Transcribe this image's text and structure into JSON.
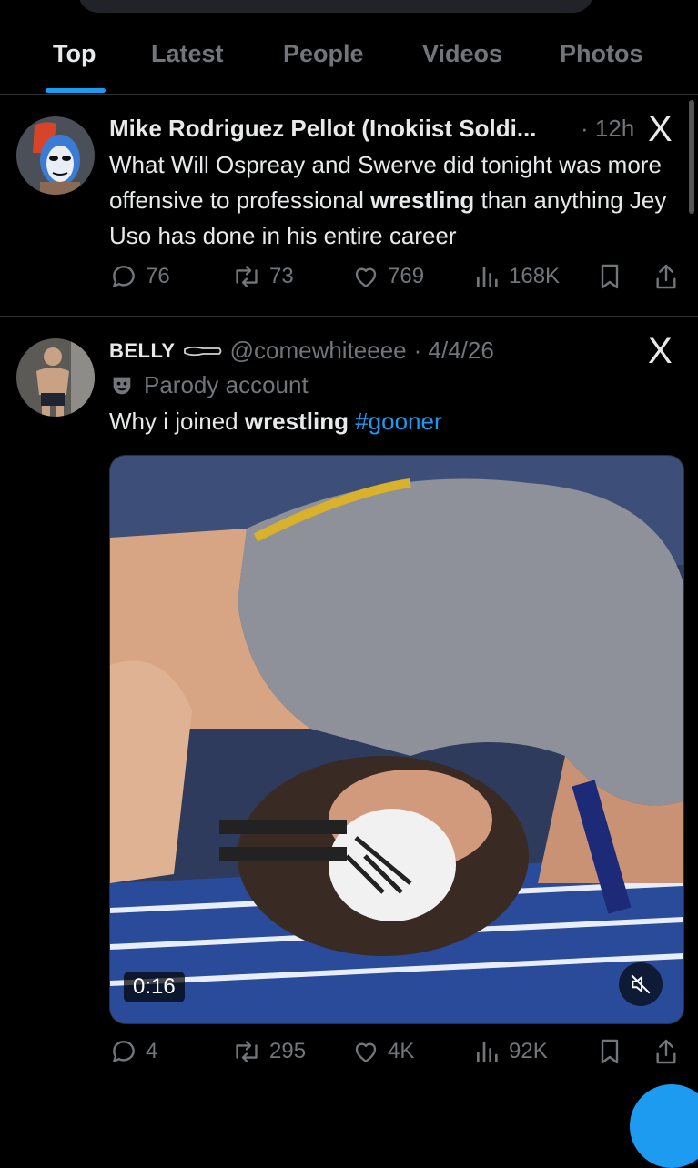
{
  "tabs": [
    {
      "label": "Top",
      "active": true
    },
    {
      "label": "Latest",
      "active": false
    },
    {
      "label": "People",
      "active": false
    },
    {
      "label": "Videos",
      "active": false
    },
    {
      "label": "Photos",
      "active": false
    }
  ],
  "posts": [
    {
      "display_name": "Mike Rodriguez Pellot (Inokiist Soldi...",
      "time": "· 12h",
      "text_parts": [
        "What Will Ospreay and Swerve did tonight was more offensive to professional ",
        "wrestling",
        " than anything Jey Uso has done in his entire career"
      ],
      "replies": "76",
      "reposts": "73",
      "likes": "769",
      "views": "168K"
    },
    {
      "display_name": "BELLY",
      "handle": "@comewhiteeee",
      "time": "· 4/4/26",
      "label": "Parody account",
      "text_parts": [
        "Why i joined ",
        "wrestling",
        " ",
        "#gooner"
      ],
      "video_time": "0:16",
      "replies": "4",
      "reposts": "295",
      "likes": "4K",
      "views": "92K"
    }
  ],
  "icons": {
    "x_logo": "X",
    "accent": "#1d9bf0"
  }
}
